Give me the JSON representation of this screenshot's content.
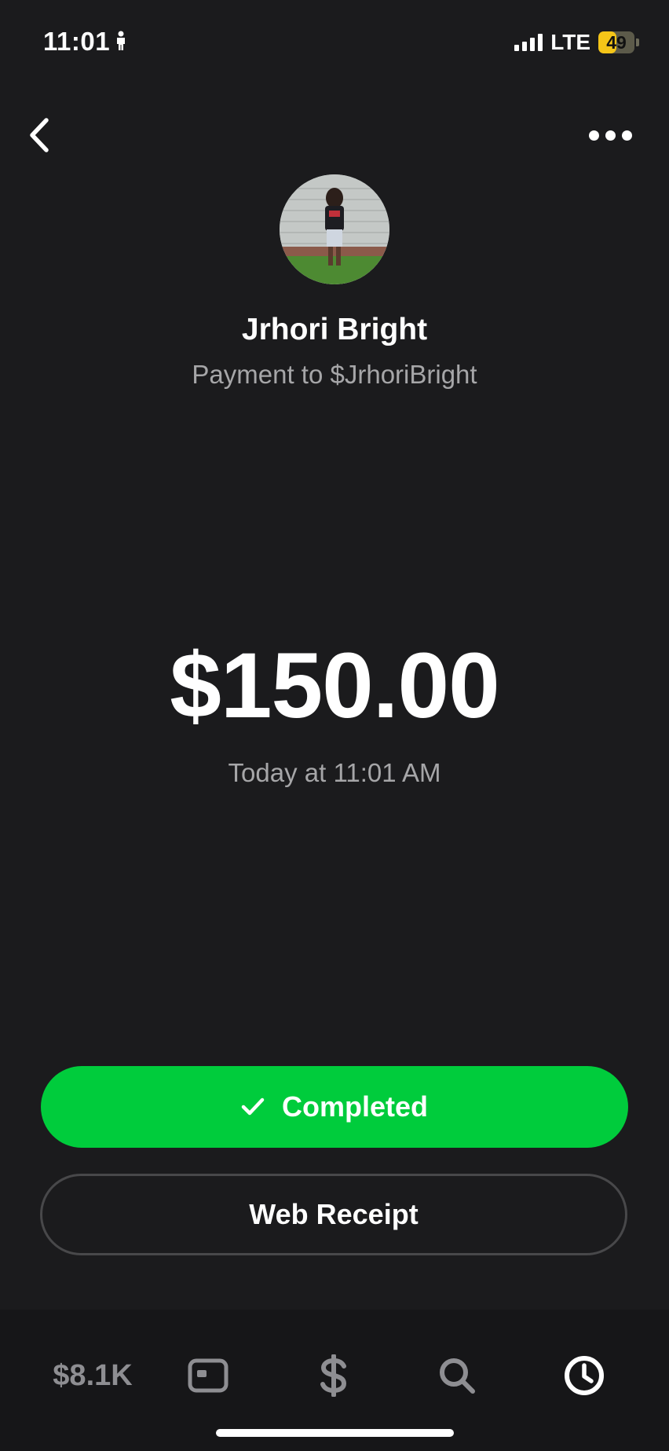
{
  "status_bar": {
    "time": "11:01",
    "network": "LTE",
    "battery_level": "49",
    "battery_percent": 49,
    "icons": [
      "person-icon",
      "signal-icon",
      "battery-icon"
    ]
  },
  "header": {
    "back_icon": "chevron-left-icon",
    "more_icon": "more-horizontal-icon"
  },
  "recipient": {
    "name": "Jrhori Bright",
    "subtitle": "Payment to $JrhoriBright"
  },
  "payment": {
    "amount": "$150.00",
    "timestamp": "Today at 11:01 AM"
  },
  "actions": {
    "status_label": "Completed",
    "status_icon": "checkmark-icon",
    "receipt_label": "Web Receipt"
  },
  "bottom_nav": {
    "balance": "$8.1K",
    "icons": [
      "card-icon",
      "dollar-icon",
      "search-icon",
      "clock-icon"
    ]
  },
  "colors": {
    "background": "#1b1b1d",
    "accent_green": "#00cc3c",
    "secondary_text": "#a6a6a8",
    "battery_yellow": "#f5c518"
  }
}
